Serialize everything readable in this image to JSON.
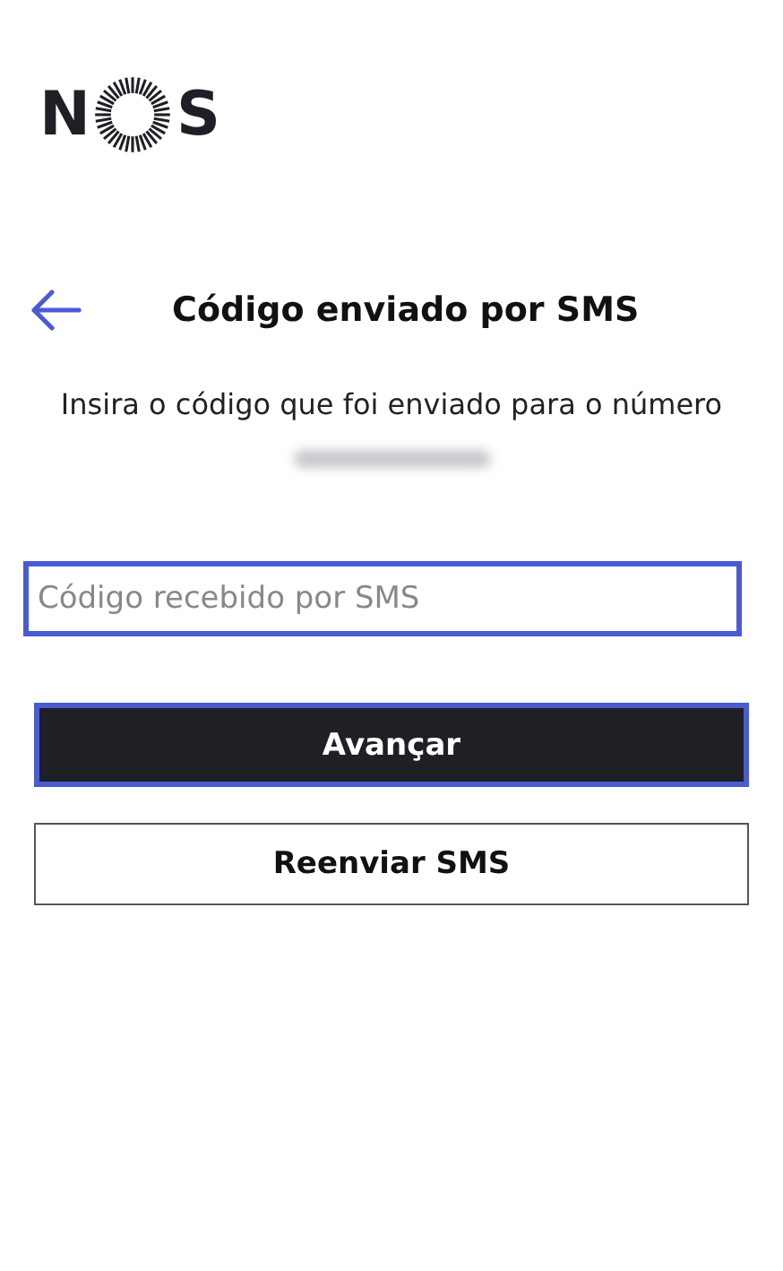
{
  "logo": {
    "before": "N",
    "after": "S"
  },
  "header": {
    "title": "Código enviado por SMS"
  },
  "instructions": "Insira o código que foi enviado para o número",
  "phone_number": {
    "redacted": true
  },
  "code_field": {
    "placeholder": "Código recebido por SMS",
    "focused": true
  },
  "buttons": [
    {
      "label": "Avançar",
      "kind": "primary",
      "focused": true
    },
    {
      "label": "Reenviar SMS",
      "kind": "secondary",
      "focused": false
    }
  ]
}
